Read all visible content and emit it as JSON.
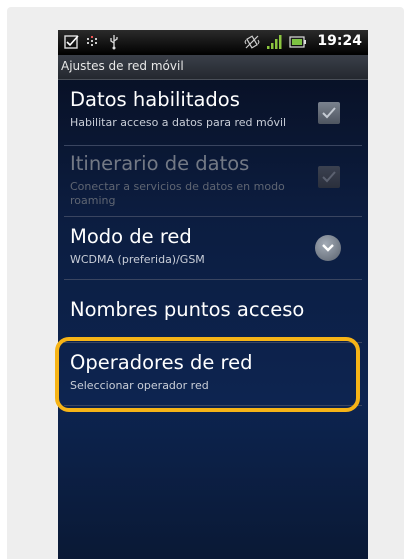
{
  "status_bar": {
    "time": "19:24",
    "icons": [
      "checkbox-notification-icon",
      "equalizer-icon",
      "usb-icon",
      "vibrate-icon",
      "signal-icon",
      "battery-icon"
    ]
  },
  "screen_title": "Ajustes de red móvil",
  "settings": [
    {
      "title": "Datos habilitados",
      "summary": "Habilitar acceso a datos para red móvil",
      "control": "checkbox",
      "checked": true,
      "enabled": true
    },
    {
      "title": "Itinerario de datos",
      "summary_line1": "Conectar a servicios de datos en modo",
      "summary_line2": "roaming",
      "control": "checkbox",
      "checked": true,
      "enabled": false
    },
    {
      "title": "Modo de red",
      "summary": "WCDMA (preferida)/GSM",
      "control": "dropdown",
      "enabled": true
    },
    {
      "title": "Nombres puntos acceso",
      "enabled": true
    },
    {
      "title": "Operadores de red",
      "summary": "Seleccionar operador red",
      "enabled": true,
      "highlighted": true
    }
  ],
  "colors": {
    "highlight": "#f6b417",
    "background": "#0c1d40"
  }
}
